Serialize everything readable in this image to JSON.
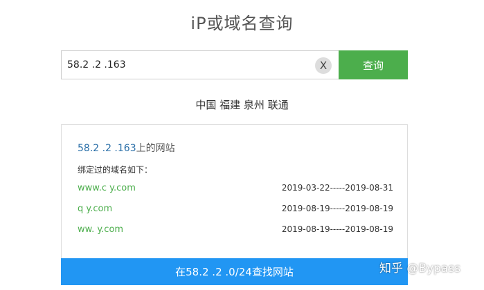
{
  "page": {
    "title": "iP或域名查询"
  },
  "search": {
    "value": "58.2 .2 .163",
    "clear_label": "X",
    "query_label": "查询"
  },
  "location": {
    "text": "中国 福建 泉州 联通"
  },
  "result": {
    "heading_ip": "58.2 .2 .163",
    "heading_suffix": "上的网站",
    "bound_label": "绑定过的域名如下：",
    "domains": [
      {
        "domain": "www.c y.com",
        "dates": "2019-03-22-----2019-08-31"
      },
      {
        "domain": "q y.com",
        "dates": "2019-08-19-----2019-08-19"
      },
      {
        "domain": "ww. y.com",
        "dates": "2019-08-19-----2019-08-19"
      }
    ]
  },
  "range_search": {
    "label": "在58.2 .2 .0/24查找网站"
  },
  "watermark": {
    "text": "知乎 @Bypass"
  },
  "colors": {
    "query_button": "#4cae4c",
    "range_button": "#2196f3",
    "domain_link": "#4cae4c",
    "heading_ip": "#2a6fa8"
  }
}
